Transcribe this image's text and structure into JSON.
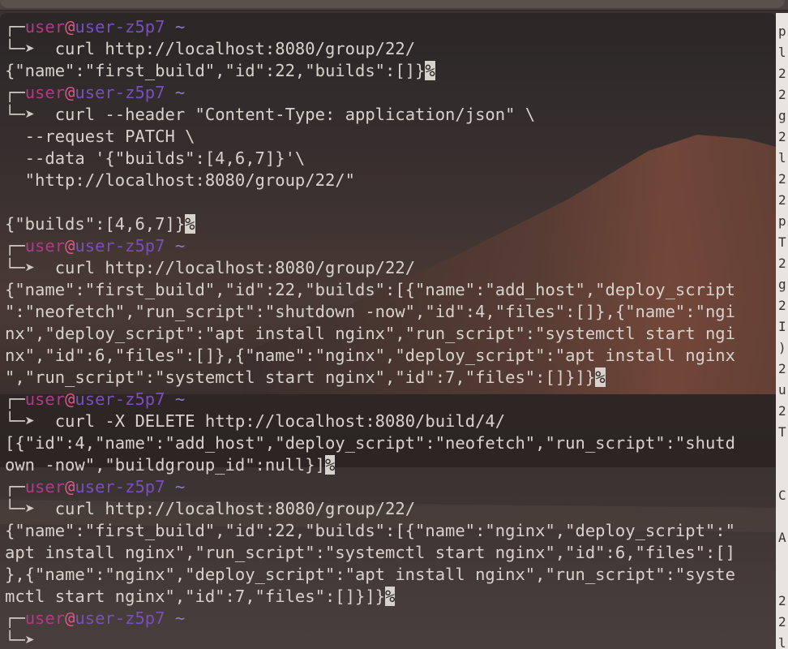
{
  "prompt": {
    "user": "user",
    "at": "@",
    "host": "user-z5p7",
    "dir": "~",
    "arrow": "➤"
  },
  "blocks": [
    {
      "command": "curl http://localhost:8080/group/22/",
      "output": [
        "{\"name\":\"first_build\",\"id\":22,\"builds\":[]}"
      ]
    },
    {
      "command": "curl --header \"Content-Type: application/json\" \\",
      "continuation": [
        "--request PATCH \\",
        "--data '{\"builds\":[4,6,7]}'\\",
        "\"http://localhost:8080/group/22/\"",
        ""
      ],
      "output": [
        "{\"builds\":[4,6,7]}"
      ]
    },
    {
      "command": "curl http://localhost:8080/group/22/",
      "output": [
        "{\"name\":\"first_build\",\"id\":22,\"builds\":[{\"name\":\"add_host\",\"deploy_script",
        "\":\"neofetch\",\"run_script\":\"shutdown -now\",\"id\":4,\"files\":[]},{\"name\":\"ngi",
        "nx\",\"deploy_script\":\"apt install nginx\",\"run_script\":\"systemctl start ngi",
        "nx\",\"id\":6,\"files\":[]},{\"name\":\"nginx\",\"deploy_script\":\"apt install nginx",
        "\",\"run_script\":\"systemctl start nginx\",\"id\":7,\"files\":[]}]}"
      ]
    },
    {
      "command": "curl -X DELETE http://localhost:8080/build/4/",
      "output": [
        "[{\"id\":4,\"name\":\"add_host\",\"deploy_script\":\"neofetch\",\"run_script\":\"shutd",
        "own -now\",\"buildgroup_id\":null}]"
      ]
    },
    {
      "command": "curl http://localhost:8080/group/22/",
      "output": [
        "{\"name\":\"first_build\",\"id\":22,\"builds\":[{\"name\":\"nginx\",\"deploy_script\":\"",
        "apt install nginx\",\"run_script\":\"systemctl start nginx\",\"id\":6,\"files\":[]",
        "},{\"name\":\"nginx\",\"deploy_script\":\"apt install nginx\",\"run_script\":\"syste",
        "mctl start nginx\",\"id\":7,\"files\":[]}]}"
      ]
    }
  ],
  "percent_marker": "%",
  "side_panel_chars": [
    "p",
    "l",
    "2",
    "2",
    "g",
    "2",
    "l",
    "2",
    "2",
    "p",
    "T",
    "2",
    "g",
    "2",
    "I",
    ")",
    "2",
    "u",
    "2",
    "T",
    "",
    "",
    "C",
    "",
    "A",
    "",
    "",
    "2",
    "2",
    "l"
  ]
}
